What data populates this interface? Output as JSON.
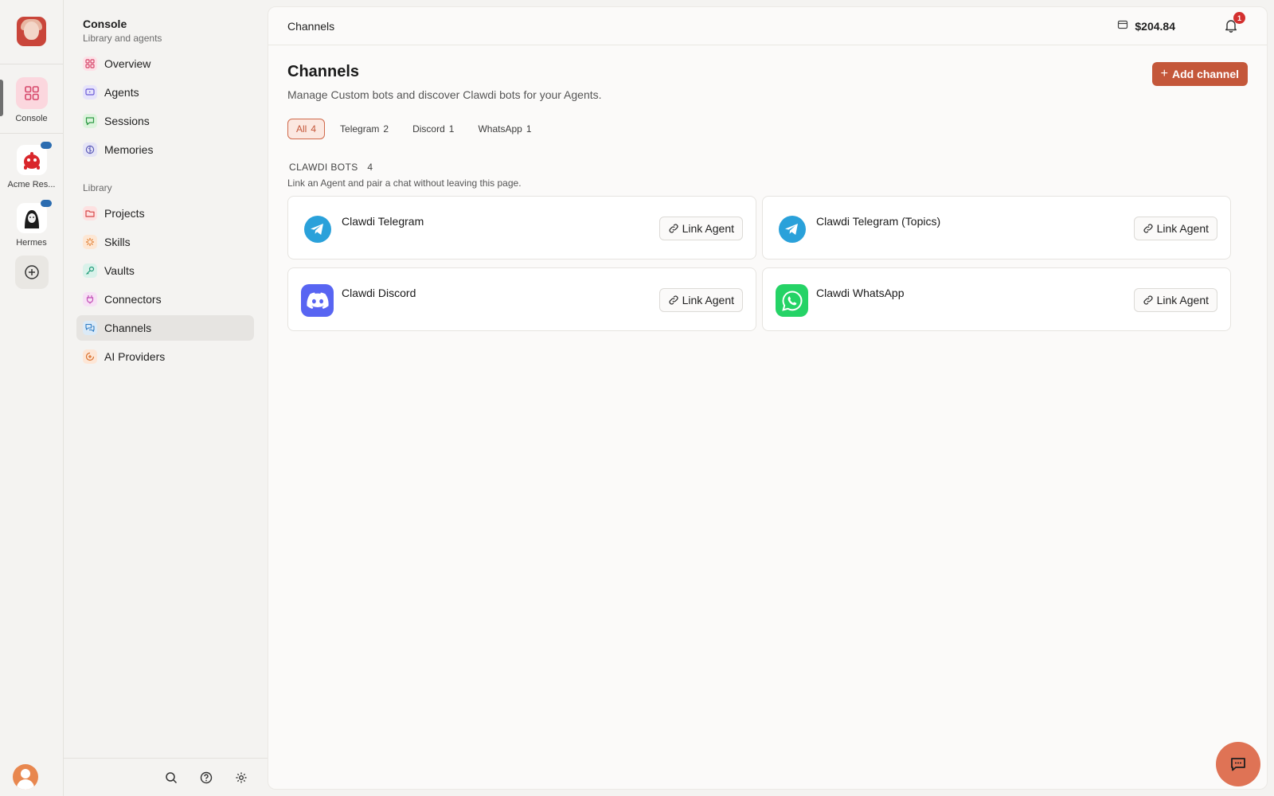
{
  "rail": {
    "items": [
      {
        "label": "Console"
      },
      {
        "label": "Acme Res..."
      },
      {
        "label": "Hermes"
      }
    ]
  },
  "sidebar": {
    "title": "Console",
    "subtitle": "Library and agents",
    "nav_main": [
      {
        "label": "Overview",
        "icon": "overview-icon"
      },
      {
        "label": "Agents",
        "icon": "agents-icon"
      },
      {
        "label": "Sessions",
        "icon": "sessions-icon"
      },
      {
        "label": "Memories",
        "icon": "memories-icon"
      }
    ],
    "section_label": "Library",
    "nav_library": [
      {
        "label": "Projects",
        "icon": "projects-icon"
      },
      {
        "label": "Skills",
        "icon": "skills-icon"
      },
      {
        "label": "Vaults",
        "icon": "vaults-icon"
      },
      {
        "label": "Connectors",
        "icon": "connectors-icon"
      },
      {
        "label": "Channels",
        "icon": "channels-icon",
        "active": true
      },
      {
        "label": "AI Providers",
        "icon": "ai-providers-icon"
      }
    ]
  },
  "topbar": {
    "breadcrumb": "Channels",
    "balance": "$204.84",
    "notification_count": "1"
  },
  "page": {
    "title": "Channels",
    "description": "Manage Custom bots and discover Clawdi bots for your Agents.",
    "add_button": "Add channel",
    "tabs": [
      {
        "label": "All",
        "count": "4",
        "active": true
      },
      {
        "label": "Telegram",
        "count": "2"
      },
      {
        "label": "Discord",
        "count": "1"
      },
      {
        "label": "WhatsApp",
        "count": "1"
      }
    ],
    "section": {
      "title": "CLAWDI BOTS",
      "count": "4",
      "description": "Link an Agent and pair a chat without leaving this page."
    },
    "cards": [
      {
        "name": "Clawdi Telegram",
        "icon": "telegram-icon",
        "action": "Link Agent"
      },
      {
        "name": "Clawdi Telegram (Topics)",
        "icon": "telegram-icon",
        "action": "Link Agent"
      },
      {
        "name": "Clawdi Discord",
        "icon": "discord-icon",
        "action": "Link Agent"
      },
      {
        "name": "Clawdi WhatsApp",
        "icon": "whatsapp-icon",
        "action": "Link Agent"
      }
    ]
  },
  "colors": {
    "accent": "#c4573a",
    "telegram": "#2aa1da",
    "discord": "#5865f2",
    "whatsapp": "#25d366"
  }
}
